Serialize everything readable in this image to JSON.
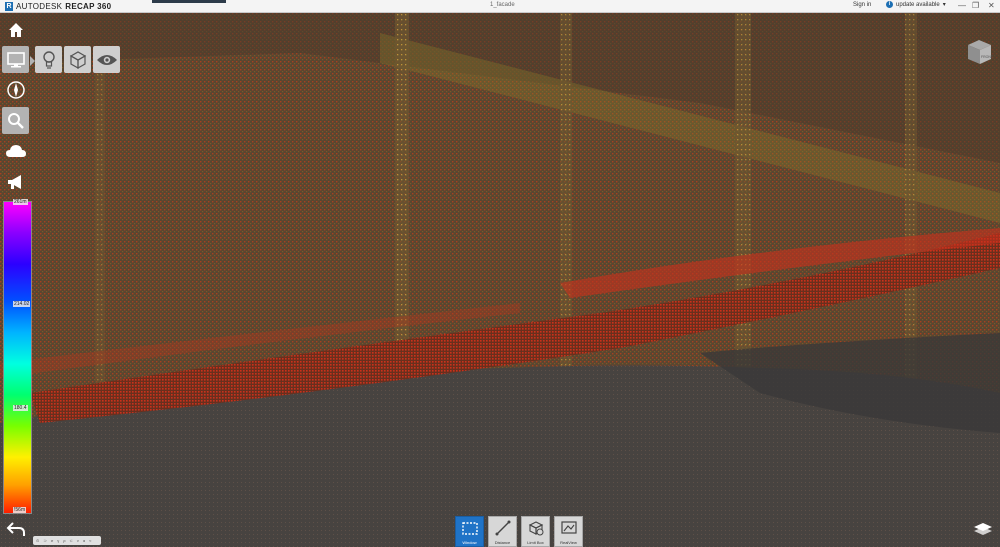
{
  "titlebar": {
    "brand_autodesk": "AUTODESK",
    "brand_product": "RECAP 360",
    "logo_letter": "R",
    "document_name": "1_facade",
    "sign_in": "Sign in",
    "update": "update available",
    "update_arrow": "▾",
    "info_glyph": "i",
    "win_minimize": "—",
    "win_restore": "❐",
    "win_close": "✕"
  },
  "toolbar": {
    "items": [
      {
        "icon": "home-icon",
        "active": false
      },
      {
        "icon": "display-icon",
        "active": true
      },
      {
        "icon": "lightbulb-icon",
        "active": false
      },
      {
        "icon": "cube-icon",
        "active": false
      },
      {
        "icon": "eye-icon",
        "active": false
      },
      {
        "icon": "compass-icon",
        "active": false
      },
      {
        "icon": "search-icon",
        "active": true
      },
      {
        "icon": "cloud-icon",
        "active": false
      },
      {
        "icon": "megaphone-icon",
        "active": false
      },
      {
        "icon": "back-arrow-icon",
        "active": false
      }
    ]
  },
  "legend": {
    "top": "261m",
    "middle": "214.02",
    "lower": "180.4",
    "bottom": "!56m",
    "colors": [
      "#ff00ff",
      "#2c00ff",
      "#00b4ff",
      "#00ff70",
      "#fff000",
      "#ff1e00"
    ]
  },
  "dock": {
    "buttons": [
      {
        "label": "Window",
        "icon": "window-select-icon",
        "active": true
      },
      {
        "label": "Distance",
        "icon": "distance-icon",
        "active": false
      },
      {
        "label": "Limit Box",
        "icon": "limit-box-icon",
        "active": false
      },
      {
        "label": "RealView",
        "icon": "realview-icon",
        "active": false
      }
    ]
  },
  "navbar": {
    "items": [
      "⊙",
      "⊃",
      "σ",
      "γ",
      "ρ",
      "⊂",
      "ν",
      "α",
      "≈"
    ]
  },
  "viewcube": {
    "label": "FRONT"
  },
  "scene": {
    "background": "#55452f",
    "primary_point_color": "#b5411f",
    "secondary_point_color": "#d99a2a",
    "dark_area": "#3a3a3a"
  }
}
